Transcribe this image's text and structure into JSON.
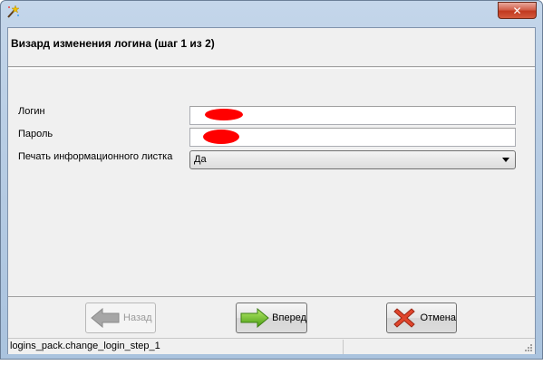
{
  "window": {
    "close_symbol": "✕",
    "app_icon": "magic-wand-icon"
  },
  "header": {
    "title": "Визард изменения логина (шаг 1 из 2)"
  },
  "form": {
    "login_label": "Логин",
    "login_value_redacted": true,
    "password_label": "Пароль",
    "password_value_redacted": true,
    "print_label": "Печать информационного листка",
    "print_value": "Да"
  },
  "buttons": {
    "back_label": "Назад",
    "back_enabled": false,
    "next_label": "Вперед",
    "cancel_label": "Отмена"
  },
  "statusbar": {
    "text": "logins_pack.change_login_step_1"
  },
  "colors": {
    "redaction": "#ff0000",
    "next_arrow": "#5fb61f",
    "cancel_x": "#e0452c",
    "back_arrow_disabled": "#a6a6a6"
  }
}
